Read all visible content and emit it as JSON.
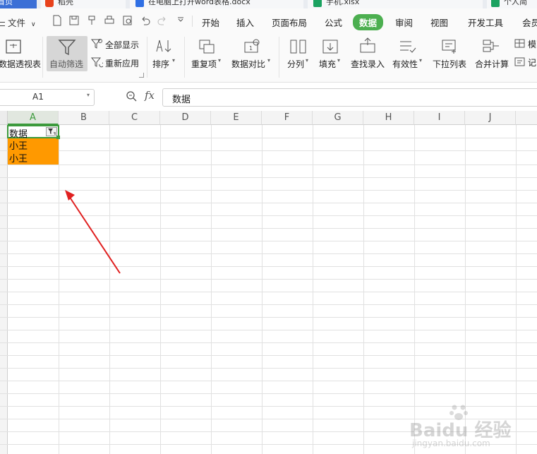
{
  "tabs": [
    {
      "label": "首页"
    },
    {
      "label": "稻壳"
    },
    {
      "label": "在电脑上打开word表格.docx"
    },
    {
      "label": "手机.xlsx"
    },
    {
      "label": "个人简历.xlsx"
    }
  ],
  "menu": {
    "file_label": "文件",
    "tabs": [
      "开始",
      "插入",
      "页面布局",
      "公式",
      "数据",
      "审阅",
      "视图",
      "开发工具",
      "会员"
    ],
    "active_tab": "数据"
  },
  "ribbon": {
    "pivot": "数据透视表",
    "autofilter": "自动筛选",
    "show_all": "全部显示",
    "reapply": "重新应用",
    "sort": "排序",
    "duplicates": "重复项",
    "compare": "数据对比",
    "split": "分列",
    "fill": "填充",
    "lookup": "查找录入",
    "validity": "有效性",
    "dropdown": "下拉列表",
    "consolidate": "合并计算",
    "mock": "模",
    "record": "记"
  },
  "formula_bar": {
    "name_box": "A1",
    "fx": "fx",
    "content": "数据"
  },
  "sheet": {
    "columns": [
      "A",
      "B",
      "C",
      "D",
      "E",
      "F",
      "G",
      "H",
      "I",
      "J"
    ],
    "a1": "数据",
    "a2": "小王",
    "a3": "小王",
    "highlight_color": "#ff9900",
    "active_border_color": "#3c9a3c"
  },
  "annotation": {
    "arrow_color": "#e02020"
  },
  "watermark": {
    "brand": "Baidu 经验",
    "url": "jingyan.baidu.com"
  }
}
